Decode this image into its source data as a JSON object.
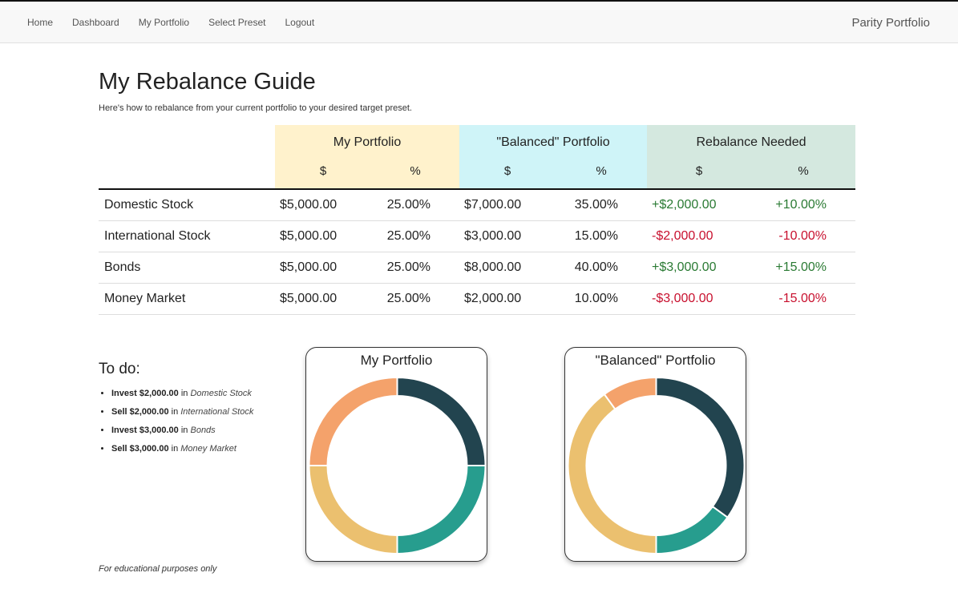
{
  "nav": {
    "items": [
      "Home",
      "Dashboard",
      "My Portfolio",
      "Select Preset",
      "Logout"
    ],
    "brand": "Parity Portfolio"
  },
  "page": {
    "title": "My Rebalance Guide",
    "subtitle": "Here's how to rebalance from your current portfolio to your desired target preset."
  },
  "table": {
    "groups": [
      "My Portfolio",
      "\"Balanced\" Portfolio",
      "Rebalance Needed"
    ],
    "subheaders": [
      "$",
      "%",
      "$",
      "%",
      "$",
      "%"
    ],
    "rows": [
      {
        "asset": "Domestic Stock",
        "my_amt": "$5,000.00",
        "my_pct": "25.00%",
        "bal_amt": "$7,000.00",
        "bal_pct": "35.00%",
        "reb_amt": "+$2,000.00",
        "reb_pct": "+10.00%",
        "dir": "pos"
      },
      {
        "asset": "International Stock",
        "my_amt": "$5,000.00",
        "my_pct": "25.00%",
        "bal_amt": "$3,000.00",
        "bal_pct": "15.00%",
        "reb_amt": "-$2,000.00",
        "reb_pct": "-10.00%",
        "dir": "neg"
      },
      {
        "asset": "Bonds",
        "my_amt": "$5,000.00",
        "my_pct": "25.00%",
        "bal_amt": "$8,000.00",
        "bal_pct": "40.00%",
        "reb_amt": "+$3,000.00",
        "reb_pct": "+15.00%",
        "dir": "pos"
      },
      {
        "asset": "Money Market",
        "my_amt": "$5,000.00",
        "my_pct": "25.00%",
        "bal_amt": "$2,000.00",
        "bal_pct": "10.00%",
        "reb_amt": "-$3,000.00",
        "reb_pct": "-15.00%",
        "dir": "neg"
      }
    ]
  },
  "todo": {
    "heading": "To do:",
    "items": [
      {
        "action": "Invest $2,000.00",
        "in": "in",
        "asset": "Domestic Stock"
      },
      {
        "action": "Sell $2,000.00",
        "in": "in",
        "asset": "International Stock"
      },
      {
        "action": "Invest $3,000.00",
        "in": "in",
        "asset": "Bonds"
      },
      {
        "action": "Sell $3,000.00",
        "in": "in",
        "asset": "Money Market"
      }
    ]
  },
  "footnote": "For educational purposes only",
  "colors": {
    "domestic_stock": "#22444f",
    "international_stock": "#279d8e",
    "bonds": "#ebc06f",
    "money_market": "#f4a26b",
    "positive": "#2a7a33",
    "negative": "#c8102e"
  },
  "charts": {
    "my": {
      "title": "My Portfolio"
    },
    "balanced": {
      "title": "\"Balanced\" Portfolio"
    }
  },
  "chart_data": [
    {
      "type": "pie",
      "title": "My Portfolio",
      "categories": [
        "Domestic Stock",
        "International Stock",
        "Bonds",
        "Money Market"
      ],
      "values": [
        25,
        25,
        25,
        25
      ],
      "colors": [
        "#22444f",
        "#279d8e",
        "#ebc06f",
        "#f4a26b"
      ]
    },
    {
      "type": "pie",
      "title": "\"Balanced\" Portfolio",
      "categories": [
        "Domestic Stock",
        "International Stock",
        "Bonds",
        "Money Market"
      ],
      "values": [
        35,
        15,
        40,
        10
      ],
      "colors": [
        "#22444f",
        "#279d8e",
        "#ebc06f",
        "#f4a26b"
      ]
    }
  ]
}
